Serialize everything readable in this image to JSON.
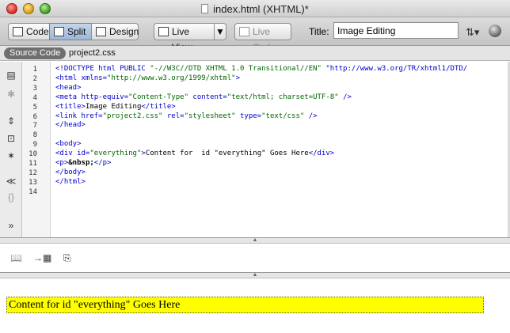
{
  "window": {
    "title": "index.html (XHTML)*"
  },
  "toolbar": {
    "code_label": "Code",
    "split_label": "Split",
    "design_label": "Design",
    "live_view_label": "Live View",
    "live_code_label": "Live Code",
    "title_label": "Title:",
    "title_value": "Image Editing",
    "icons": [
      "upload-icon",
      "globe-icon"
    ]
  },
  "related_files": {
    "source_code": "Source Code",
    "css_file": "project2.css"
  },
  "code": {
    "lines": [
      {
        "n": "1",
        "text": "<!DOCTYPE html PUBLIC \"-//W3C//DTD XHTML 1.0 Transitional//EN\" \"http://www.w3.org/TR/xhtml1/DTD/"
      },
      {
        "n": "2",
        "text": "<html xmlns=\"http://www.w3.org/1999/xhtml\">"
      },
      {
        "n": "3",
        "text": "<head>"
      },
      {
        "n": "4",
        "text": "<meta http-equiv=\"Content-Type\" content=\"text/html; charset=UTF-8\" />"
      },
      {
        "n": "5",
        "text": "<title>Image Editing</title>"
      },
      {
        "n": "6",
        "text": "<link href=\"project2.css\" rel=\"stylesheet\" type=\"text/css\" />"
      },
      {
        "n": "7",
        "text": "</head>"
      },
      {
        "n": "8",
        "text": ""
      },
      {
        "n": "9",
        "text": "<body>"
      },
      {
        "n": "10",
        "text": "<div id=\"everything\">Content for  id \"everything\" Goes Here</div>"
      },
      {
        "n": "11",
        "text": "<p>&nbsp;</p>"
      },
      {
        "n": "12",
        "text": "</body>"
      },
      {
        "n": "13",
        "text": "</html>"
      },
      {
        "n": "14",
        "text": ""
      }
    ]
  },
  "colors": {
    "tag": "#0000cc",
    "attr_value": "#006600",
    "entity": "#000000",
    "div_background": "#ffff00"
  },
  "design": {
    "div_content": "Content for id \"everything\" Goes Here"
  }
}
